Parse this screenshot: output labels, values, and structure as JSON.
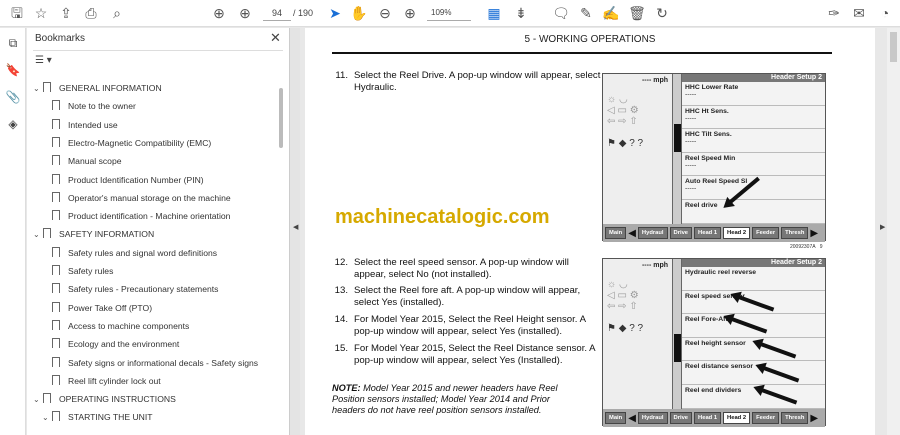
{
  "toolbar": {
    "page_current": "94",
    "page_total": "/ 190",
    "zoom": "109%"
  },
  "bookmarks": {
    "title": "Bookmarks",
    "items": [
      {
        "label": "GENERAL INFORMATION",
        "level": 0,
        "expanded": true
      },
      {
        "label": "Note to the owner",
        "level": 1
      },
      {
        "label": "Intended use",
        "level": 1
      },
      {
        "label": "Electro-Magnetic Compatibility (EMC)",
        "level": 1
      },
      {
        "label": "Manual scope",
        "level": 1
      },
      {
        "label": "Product Identification Number (PIN)",
        "level": 1
      },
      {
        "label": "Operator's manual storage on the machine",
        "level": 1
      },
      {
        "label": "Product identification - Machine orientation",
        "level": 1
      },
      {
        "label": "SAFETY INFORMATION",
        "level": 0,
        "expanded": true
      },
      {
        "label": "Safety rules and signal word definitions",
        "level": 1
      },
      {
        "label": "Safety rules",
        "level": 1
      },
      {
        "label": "Safety rules - Precautionary statements",
        "level": 1
      },
      {
        "label": "Power Take Off (PTO)",
        "level": 1
      },
      {
        "label": "Access to machine components",
        "level": 1
      },
      {
        "label": "Ecology and the environment",
        "level": 1
      },
      {
        "label": "Safety signs or informational decals - Safety signs",
        "level": 1
      },
      {
        "label": "Reel lift cylinder lock out",
        "level": 1
      },
      {
        "label": "OPERATING INSTRUCTIONS",
        "level": 0,
        "expanded": true
      },
      {
        "label": "STARTING THE UNIT",
        "level": 1,
        "expanded": true
      }
    ]
  },
  "document": {
    "section": "5 - WORKING OPERATIONS",
    "watermark": "machinecatalogic.com",
    "steps": [
      {
        "n": "11.",
        "text": "Select the Reel Drive.  A pop-up window will appear, select Hydraulic."
      },
      {
        "n": "12.",
        "text": "Select the reel speed sensor.  A pop-up window will appear, select No (not installed)."
      },
      {
        "n": "13.",
        "text": "Select the Reel fore aft. A pop-up window will appear, select Yes (installed)."
      },
      {
        "n": "14.",
        "text": "For Model Year 2015, Select the Reel Height sensor. A pop-up window will appear, select Yes (installed)."
      },
      {
        "n": "15.",
        "text": "For Model Year 2015, Select the Reel Distance sensor.  A pop-up window will appear, select Yes (Installed)."
      }
    ],
    "note_label": "NOTE:",
    "note_text": " Model Year 2015 and newer headers have Reel Position sensors installed; Model Year 2014 and Prior headers do not have reel position sensors installed.",
    "figures": [
      {
        "header": "Header Setup 2",
        "mph": "---- mph",
        "rows": [
          {
            "label": "HHC Lower Rate",
            "value": "-----"
          },
          {
            "label": "HHC Ht Sens.",
            "value": "-----"
          },
          {
            "label": "HHC Tilt Sens.",
            "value": "-----"
          },
          {
            "label": "Reel Speed Min",
            "value": "-----"
          },
          {
            "label": "Auto Reel Speed Sl",
            "value": "-----"
          },
          {
            "label": "Reel drive",
            "value": ""
          }
        ],
        "caption": "20092307A",
        "number": "9"
      },
      {
        "header": "Header Setup 2",
        "mph": "---- mph",
        "rows": [
          {
            "label": "Hydraulic reel reverse",
            "value": ""
          },
          {
            "label": "Reel speed sensor",
            "value": ""
          },
          {
            "label": "Reel Fore-Aft",
            "value": ""
          },
          {
            "label": "Reel height sensor",
            "value": ""
          },
          {
            "label": "Reel distance sensor",
            "value": ""
          },
          {
            "label": "Reel end dividers",
            "value": ""
          }
        ]
      }
    ],
    "tabs": [
      "Main",
      "Hydraul",
      "Drive",
      "Head 1",
      "Head 2",
      "Feeder",
      "Thresh"
    ]
  }
}
